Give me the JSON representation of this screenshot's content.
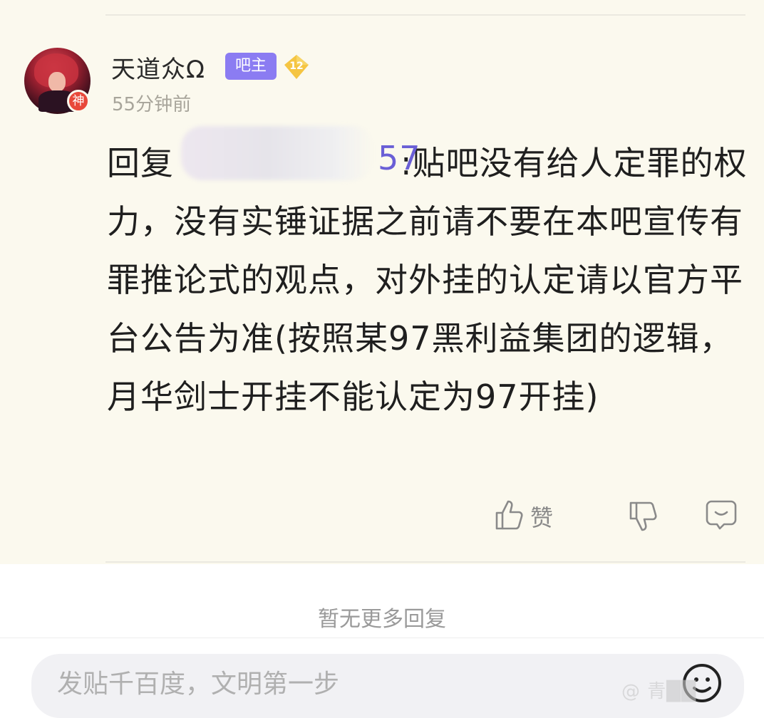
{
  "post": {
    "user": {
      "name": "天道众Ω",
      "role_badge": "吧主",
      "level": "12",
      "avatar_badge": "神"
    },
    "time": "55分钟前",
    "reply_prefix": "回复",
    "mention_visible": "57",
    "content": ":贴吧没有给人定罪的权力，没有实锤证据之前请不要在本吧宣传有罪推论式的观点，对外挂的认定请以官方平台公告为准(按照某97黑利益集团的逻辑，月华剑士开挂不能认定为97开挂)",
    "actions": {
      "like_label": "赞",
      "like_icon": "thumbs-up-icon",
      "dislike_icon": "thumbs-down-icon",
      "comment_icon": "comment-icon"
    }
  },
  "footer": {
    "no_more_text": "暂无更多回复",
    "input_placeholder": "发贴千百度，文明第一步",
    "emoji_icon": "emoji-icon",
    "watermark": "@ 青██"
  },
  "colors": {
    "post_background": "#fbf9ee",
    "role_badge": "#8b7cf2",
    "level_badge": "#f5c542",
    "mention": "#6a5fd6",
    "avatar_badge": "#e8483a"
  }
}
